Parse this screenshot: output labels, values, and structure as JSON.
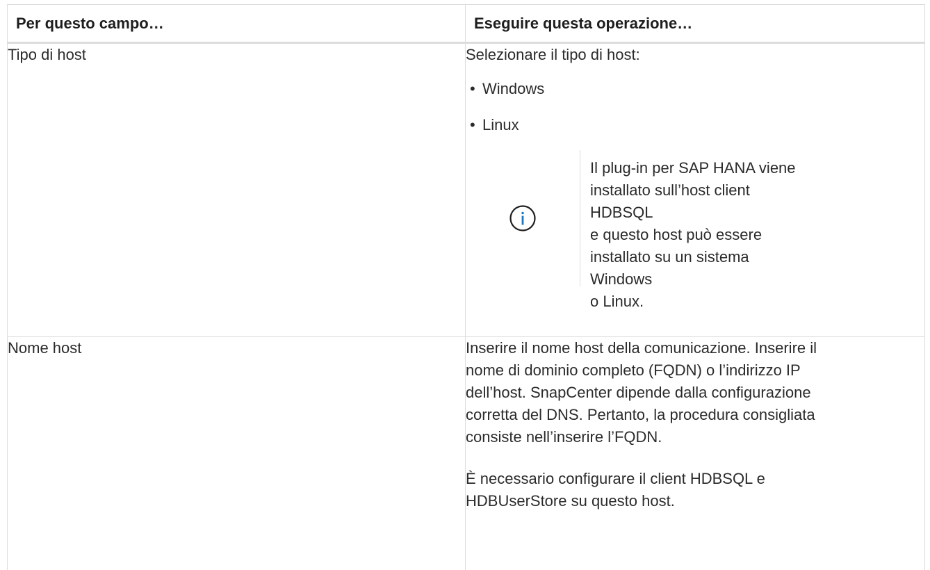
{
  "table": {
    "headers": [
      "Per questo campo…",
      "Eseguire questa operazione…"
    ],
    "rows": [
      {
        "field": "Tipo di host",
        "action_intro": "Selezionare il tipo di host:",
        "options": [
          "Windows",
          "Linux"
        ],
        "note": {
          "icon": "info-icon",
          "lines": [
            "Il plug-in per SAP HANA viene",
            "installato sull’host client HDBSQL",
            "e questo host può essere",
            "installato su un sistema Windows",
            "o Linux."
          ]
        }
      },
      {
        "field": "Nome host",
        "action_lines": [
          "Inserire il nome host della comunicazione. Inserire il",
          "nome di dominio completo (FQDN) o l’indirizzo IP",
          "dell’host. SnapCenter dipende dalla configurazione",
          "corretta del DNS. Pertanto, la procedura consigliata",
          "consiste nell’inserire l’FQDN."
        ],
        "action_lines_2": [
          "È necessario configurare il client HDBSQL e",
          "HDBUserStore su questo host."
        ]
      }
    ]
  },
  "colors": {
    "text": "#2b2b2b",
    "border": "#dcdcdc",
    "info_icon": "#1a78c2"
  },
  "bullet_char": "•"
}
